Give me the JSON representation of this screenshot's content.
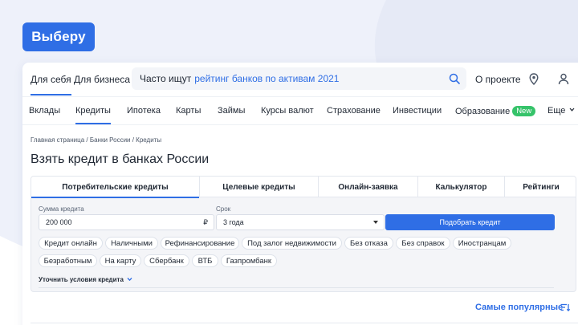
{
  "brand": {
    "logo_text": "Выберу",
    "accent": "#2f6ee5"
  },
  "topbar": {
    "segment_personal": "Для себя",
    "segment_business": "Для бизнеса",
    "search_label": "Часто ищут",
    "search_link": "рейтинг банков по активам 2021",
    "about": "О проекте"
  },
  "nav": {
    "items": [
      {
        "label": "Вклады"
      },
      {
        "label": "Кредиты"
      },
      {
        "label": "Ипотека"
      },
      {
        "label": "Карты"
      },
      {
        "label": "Займы"
      },
      {
        "label": "Курсы валют"
      },
      {
        "label": "Страхование"
      },
      {
        "label": "Инвестиции"
      },
      {
        "label": "Образование"
      },
      {
        "label": "Еще"
      }
    ],
    "new_badge": "New"
  },
  "breadcrumbs": "Главная страница / Банки России / Кредиты",
  "page_title": "Взять кредит в банках России",
  "tabs": [
    {
      "label": "Потребительские кредиты"
    },
    {
      "label": "Целевые кредиты"
    },
    {
      "label": "Онлайн-заявка"
    },
    {
      "label": "Калькулятор"
    },
    {
      "label": "Рейтинги"
    }
  ],
  "form": {
    "amount_label": "Сумма кредита",
    "amount_value": "200 000",
    "amount_suffix": "₽",
    "term_label": "Срок",
    "term_value": "3 года",
    "submit": "Подобрать кредит"
  },
  "chips": [
    {
      "label": "Кредит онлайн"
    },
    {
      "label": "Наличными"
    },
    {
      "label": "Рефинансирование"
    },
    {
      "label": "Под залог недвижимости"
    },
    {
      "label": "Без отказа"
    },
    {
      "label": "Без справок"
    },
    {
      "label": "Иностранцам"
    },
    {
      "label": "Безработным"
    },
    {
      "label": "На карту"
    },
    {
      "label": "Сбербанк"
    },
    {
      "label": "ВТБ"
    },
    {
      "label": "Газпромбанк"
    }
  ],
  "refine": "Уточнить условия кредита",
  "sort": {
    "label": "Самые популярные"
  }
}
